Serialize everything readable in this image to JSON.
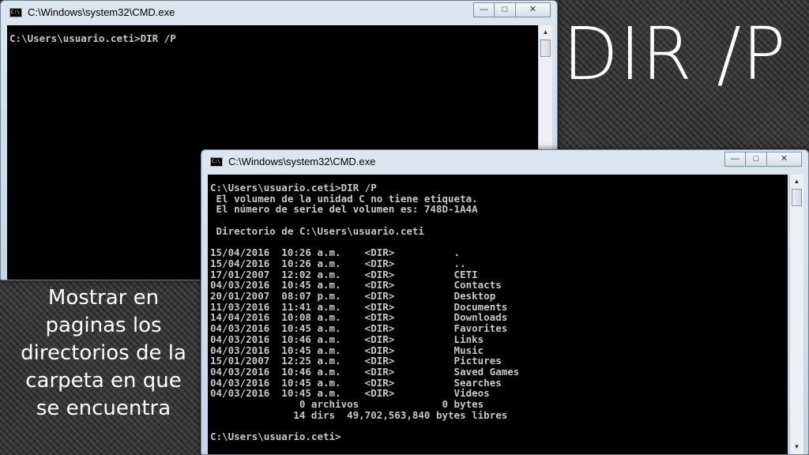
{
  "slide": {
    "title": "DIR /P",
    "caption_lines": [
      "Mostrar en",
      "paginas los",
      "directorios de la",
      "carpeta en que",
      "se encuentra"
    ]
  },
  "windows": [
    {
      "title": "C:\\Windows\\system32\\CMD.exe",
      "controls": {
        "minimize": "—",
        "maximize": "□",
        "close": "✕"
      },
      "console_text": "C:\\Users\\usuario.ceti>DIR /P"
    },
    {
      "title": "C:\\Windows\\system32\\CMD.exe",
      "controls": {
        "minimize": "—",
        "maximize": "□",
        "close": "✕"
      },
      "console_text": "C:\\Users\\usuario.ceti>DIR /P\n El volumen de la unidad C no tiene etiqueta.\n El número de serie del volumen es: 748D-1A4A\n\n Directorio de C:\\Users\\usuario.ceti\n\n15/04/2016  10:26 a.m.    <DIR>          .\n15/04/2016  10:26 a.m.    <DIR>          ..\n17/01/2007  12:02 a.m.    <DIR>          CETI\n04/03/2016  10:45 a.m.    <DIR>          Contacts\n20/01/2007  08:07 p.m.    <DIR>          Desktop\n11/03/2016  11:41 a.m.    <DIR>          Documents\n14/04/2016  10:08 a.m.    <DIR>          Downloads\n04/03/2016  10:45 a.m.    <DIR>          Favorites\n04/03/2016  10:46 a.m.    <DIR>          Links\n04/03/2016  10:45 a.m.    <DIR>          Music\n15/01/2007  12:25 a.m.    <DIR>          Pictures\n04/03/2016  10:46 a.m.    <DIR>          Saved Games\n04/03/2016  10:45 a.m.    <DIR>          Searches\n04/03/2016  10:45 a.m.    <DIR>          Videos\n               0 archivos              0 bytes\n              14 dirs  49,702,563,840 bytes libres\n\nC:\\Users\\usuario.ceti>"
    }
  ]
}
